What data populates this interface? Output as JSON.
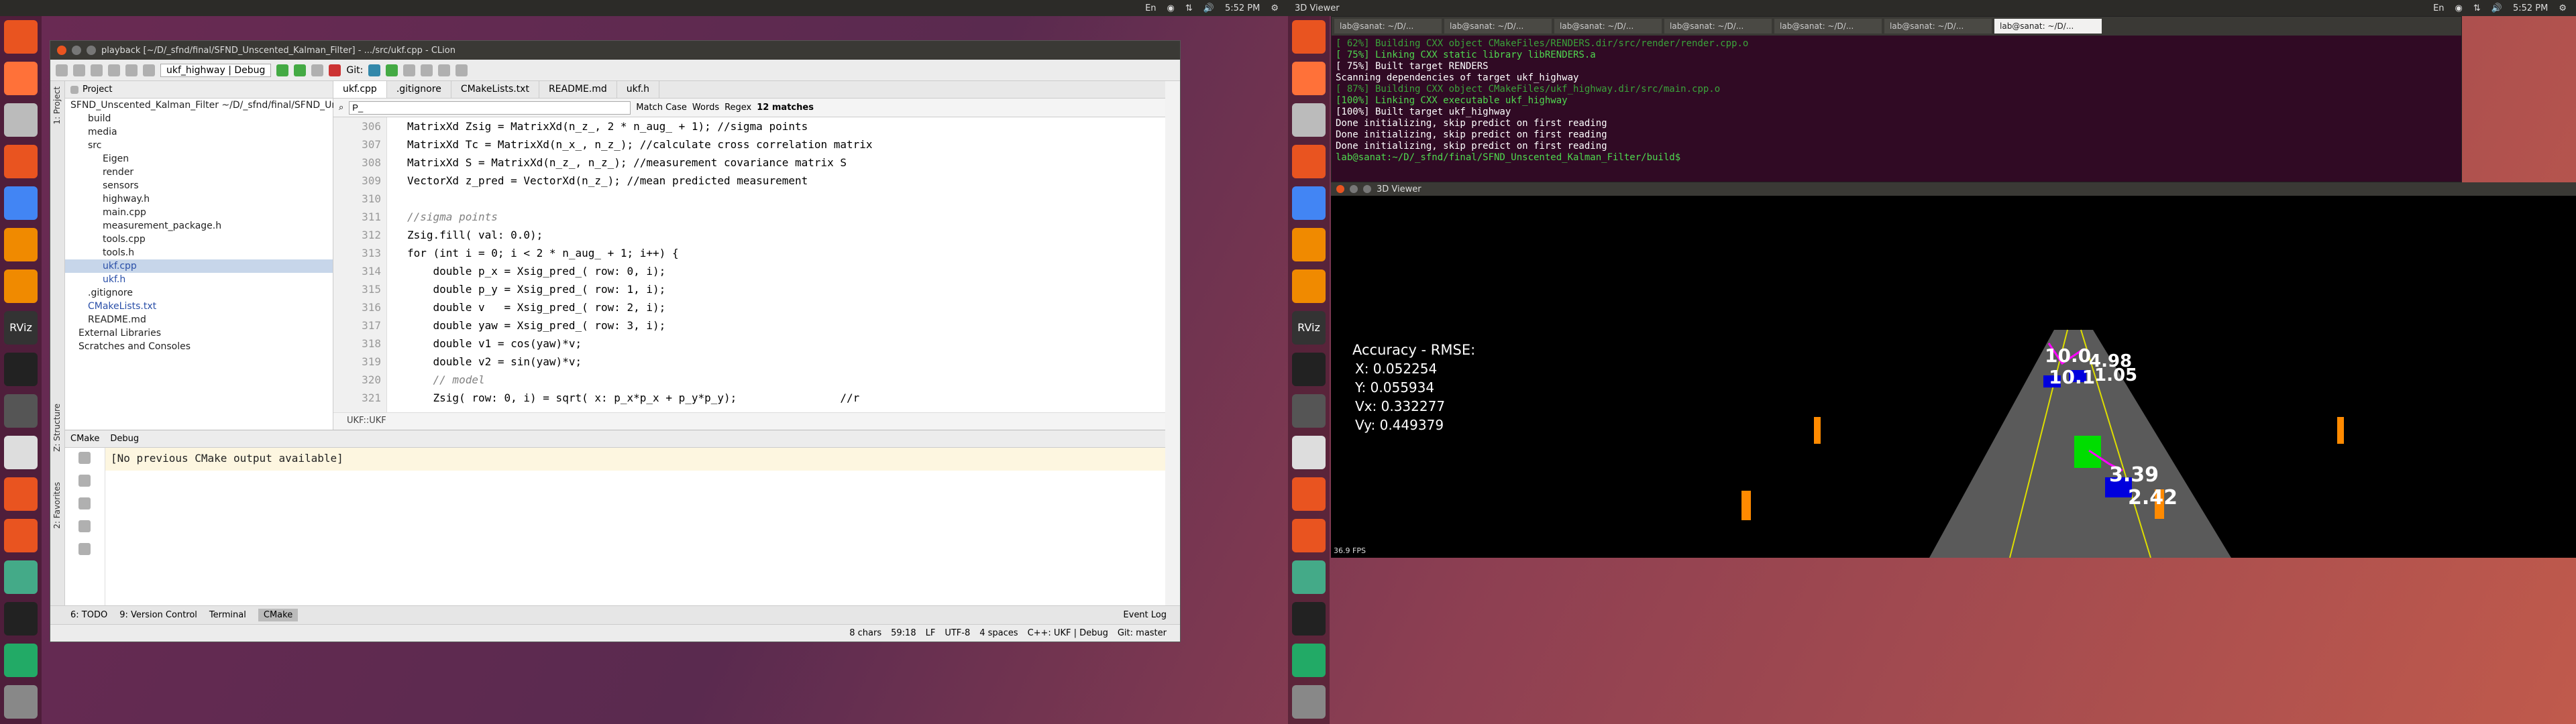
{
  "top_panel_left": {
    "indicators": [
      "En",
      "◉",
      "⇅",
      "🔊",
      "5:52 PM",
      "⚙"
    ]
  },
  "top_panel_right": {
    "app": "3D Viewer",
    "indicators": [
      "En",
      "◉",
      "⇅",
      "🔊",
      "5:52 PM",
      "⚙"
    ]
  },
  "ide": {
    "title": "playback [~/D/_sfnd/final/SFND_Unscented_Kalman_Filter] - .../src/ukf.cpp - CLion",
    "toolbar": {
      "config": "ukf_highway | Debug",
      "git": "Git:"
    },
    "project_label": "Project",
    "tree": [
      "SFND_Unscented_Kalman_Filter ~/D/_sfnd/final/SFND_Unscented_Kalman_Filter",
      "build",
      "media",
      "src",
      "Eigen",
      "render",
      "sensors",
      "highway.h",
      "main.cpp",
      "measurement_package.h",
      "tools.cpp",
      "tools.h",
      "ukf.cpp",
      "ukf.h",
      ".gitignore",
      "CMakeLists.txt",
      "README.md",
      "External Libraries",
      "Scratches and Consoles"
    ],
    "tabs": [
      "ukf.cpp",
      ".gitignore",
      "CMakeLists.txt",
      "README.md",
      "ukf.h"
    ],
    "search": {
      "value": "P_",
      "matchcase": "Match Case",
      "words": "Words",
      "regex": "Regex",
      "matches": "12 matches"
    },
    "gutter": [
      "306",
      "307",
      "308",
      "309",
      "310",
      "311",
      "312",
      "313",
      "314",
      "315",
      "316",
      "317",
      "318",
      "319",
      "320",
      "321"
    ],
    "code": [
      "MatrixXd Zsig = MatrixXd(n_z_, 2 * n_aug_ + 1); //sigma points",
      "MatrixXd Tc = MatrixXd(n_x_, n_z_); //calculate cross correlation matrix",
      "MatrixXd S = MatrixXd(n_z_, n_z_); //measurement covariance matrix S",
      "VectorXd z_pred = VectorXd(n_z_); //mean predicted measurement",
      "",
      "//sigma points",
      "Zsig.fill( val: 0.0);",
      "for (int i = 0; i < 2 * n_aug_ + 1; i++) {",
      "    double p_x = Xsig_pred_( row: 0, i);",
      "    double p_y = Xsig_pred_( row: 1, i);",
      "    double v   = Xsig_pred_( row: 2, i);",
      "    double yaw = Xsig_pred_( row: 3, i);",
      "    double v1 = cos(yaw)*v;",
      "    double v2 = sin(yaw)*v;",
      "    // model",
      "    Zsig( row: 0, i) = sqrt( x: p_x*p_x + p_y*p_y);                //r"
    ],
    "breadcrumb": "UKF::UKF",
    "cmake": {
      "tab1": "CMake",
      "tab2": "Debug",
      "output": "[No previous CMake output available]"
    },
    "bottom_tabs": [
      "6: TODO",
      "9: Version Control",
      "Terminal",
      "CMake"
    ],
    "event_log": "Event Log",
    "status": [
      "8 chars",
      "59:18",
      "LF",
      "UTF-8",
      "4 spaces",
      "C++: UKF | Debug",
      "Git: master"
    ]
  },
  "terminal": {
    "title": "lab@sanat: ~/D/_sfnd/final/SFND_Unscented_Kalman_Filter/build",
    "tabs": [
      "lab@sanat: ~/D/...",
      "lab@sanat: ~/D/...",
      "lab@sanat: ~/D/...",
      "lab@sanat: ~/D/...",
      "lab@sanat: ~/D/...",
      "lab@sanat: ~/D/...",
      "lab@sanat: ~/D/..."
    ],
    "lines": [
      "[ 62%] Building CXX object CMakeFiles/RENDERS.dir/src/render/render.cpp.o",
      "[ 75%] Linking CXX static library libRENDERS.a",
      "[ 75%] Built target RENDERS",
      "Scanning dependencies of target ukf_highway",
      "[ 87%] Building CXX object CMakeFiles/ukf_highway.dir/src/main.cpp.o",
      "[100%] Linking CXX executable ukf_highway",
      "[100%] Built target ukf_highway",
      "Done initializing, skip predict on first reading",
      "Done initializing, skip predict on first reading",
      "Done initializing, skip predict on first reading",
      "lab@sanat:~/D/_sfnd/final/SFND_Unscented_Kalman_Filter/build$"
    ]
  },
  "viewer": {
    "title": "3D Viewer",
    "rmse_title": "Accuracy - RMSE:",
    "x": "X: 0.052254",
    "y": "Y: 0.055934",
    "vx": "Vx: 0.332277",
    "vy": "Vy: 0.449379",
    "labels": [
      "10.0",
      "4.98",
      "10.1",
      "1.05",
      "3.39",
      "2.42"
    ],
    "fps": "36.9 FPS"
  }
}
